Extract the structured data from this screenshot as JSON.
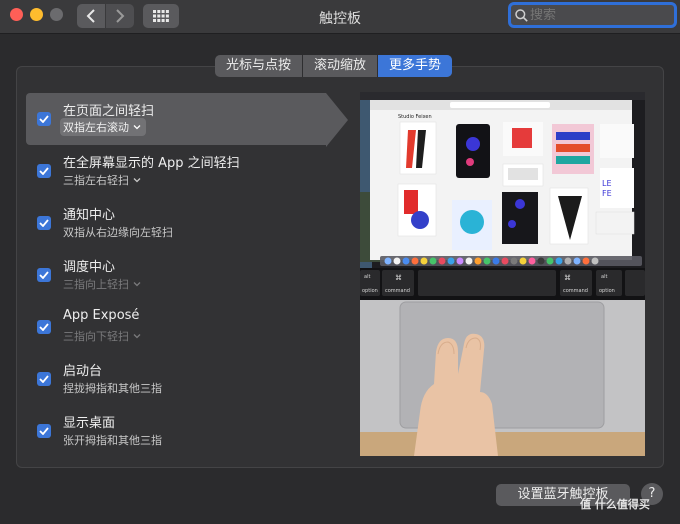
{
  "window": {
    "title": "触控板"
  },
  "search": {
    "placeholder": "搜索"
  },
  "tabs": [
    {
      "label": "光标与点按",
      "active": false
    },
    {
      "label": "滚动缩放",
      "active": false
    },
    {
      "label": "更多手势",
      "active": true
    }
  ],
  "gestures": [
    {
      "label": "在页面之间轻扫",
      "sub": "双指左右滚动",
      "checked": true
    },
    {
      "label": "在全屏幕显示的 App 之间轻扫",
      "sub": "三指左右轻扫",
      "checked": true
    },
    {
      "label": "通知中心",
      "sub": "双指从右边缘向左轻扫",
      "checked": true
    },
    {
      "label": "调度中心",
      "sub": "三指向上轻扫",
      "checked": true
    },
    {
      "label": "App Exposé",
      "sub": "三指向下轻扫",
      "checked": true
    },
    {
      "label": "启动台",
      "sub": "捏拢拇指和其他三指",
      "checked": true
    },
    {
      "label": "显示桌面",
      "sub": "张开拇指和其他三指",
      "checked": true
    }
  ],
  "preview": {
    "page_heading": "Studio Feixen",
    "keys": {
      "alt": "alt",
      "option": "option",
      "command": "command"
    }
  },
  "footer": {
    "bluetooth_button": "设置蓝牙触控板",
    "help": "?"
  },
  "watermark": "值 什么值得买",
  "colors": {
    "accent": "#3c76d8",
    "selected_row": "#5a5a5d"
  }
}
